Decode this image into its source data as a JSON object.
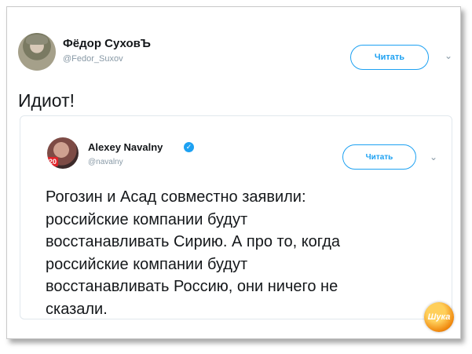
{
  "tweet": {
    "author_name": "Фёдор СуховЪ",
    "author_handle": "@Fedor_Suxov",
    "follow_label": "Читать",
    "text": "Идиот!"
  },
  "quoted_tweet": {
    "author_name": "Alexey Navalny",
    "author_handle": "@navalny",
    "follow_label": "Читать",
    "avatar_badge": "20",
    "text_lines": [
      "Рогозин и Асад совместно заявили:",
      "российские компании будут",
      "восстанавливать Сирию. А про то, когда",
      "российские компании будут",
      "восстанавливать Россию, они ничего не",
      "сказали."
    ]
  },
  "watermark": "Шука",
  "colors": {
    "accent": "#1da1f2",
    "text": "#14171a",
    "muted": "#8899a6"
  }
}
